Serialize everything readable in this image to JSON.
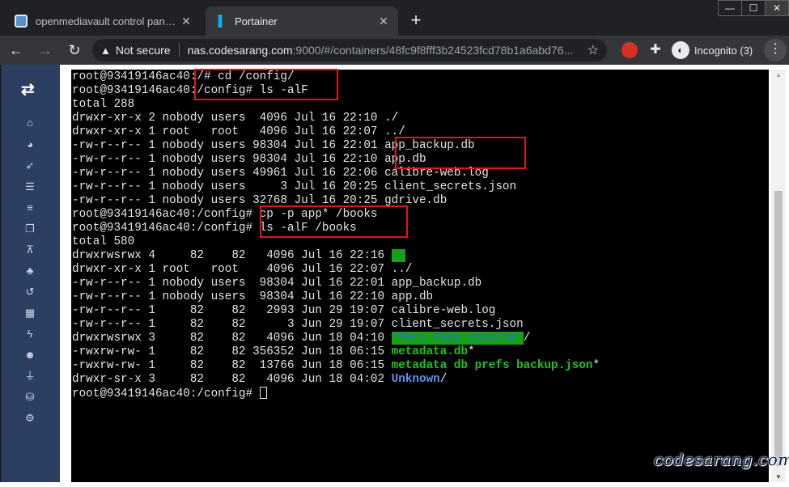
{
  "browser": {
    "tabs": [
      {
        "title": "openmediavault control panel - c",
        "active": false
      },
      {
        "title": "Portainer",
        "active": true
      }
    ],
    "new_tab": "+",
    "window_controls": {
      "minimize": "—",
      "maximize": "☐",
      "close": "✕"
    },
    "toolbar": {
      "back": "←",
      "forward": "→",
      "reload": "↻",
      "security_label": "Not secure",
      "url_host": "nas.codesarang.com",
      "url_rest": ":9000/#/containers/48fc9f8fff3b24523fcd78b1a6abd76...",
      "profile_label": "Incognito (3)"
    }
  },
  "sidebar": {
    "icons": [
      "swap-icon",
      "home-icon",
      "dashboard-icon",
      "rocket-icon",
      "list-icon",
      "server-icon",
      "copy-icon",
      "network-icon",
      "cubes-icon",
      "history-icon",
      "grid-icon",
      "bolt-icon",
      "users-icon",
      "plug-icon",
      "database-icon",
      "settings-icon"
    ]
  },
  "terminal": {
    "lines": [
      "root@93419146ac40:/# cd /config/",
      "root@93419146ac40:/config# ls -alF",
      "total 288",
      "drwxr-xr-x 2 nobody users  4096 Jul 16 22:10 ./",
      "drwxr-xr-x 1 root   root   4096 Jul 16 22:07 ../",
      "-rw-r--r-- 1 nobody users 98304 Jul 16 22:01 app_backup.db",
      "-rw-r--r-- 1 nobody users 98304 Jul 16 22:10 app.db",
      "-rw-r--r-- 1 nobody users 49961 Jul 16 22:06 calibre-web.log",
      "-rw-r--r-- 1 nobody users     3 Jul 16 20:25 client_secrets.json",
      "-rw-r--r-- 1 nobody users 32768 Jul 16 20:25 gdrive.db",
      "root@93419146ac40:/config# cp -p app* /books",
      "root@93419146ac40:/config# ls -alF /books",
      "total 580",
      "drwxrwsrwx 4     82    82   4096 Jul 16 22:16 ",
      "drwxr-xr-x 1 root   root    4096 Jul 16 22:07 ../",
      "-rw-r--r-- 1 nobody users  98304 Jul 16 22:01 app_backup.db",
      "-rw-r--r-- 1 nobody users  98304 Jul 16 22:10 app.db",
      "-rw-r--r-- 1     82    82   2993 Jun 29 19:07 calibre-web.log",
      "-rw-r--r-- 1     82    82      3 Jun 29 19:07 client_secrets.json",
      "drwxrwsrwx 3     82    82   4096 Jun 18 04:10 ",
      "-rwxrw-rw- 1     82    82 356352 Jun 18 06:15 ",
      "-rwxrw-rw- 1     82    82  13766 Jun 18 06:15 ",
      "drwxr-sr-x 3     82    82   4096 Jun 18 04:02 ",
      "root@93419146ac40:/config# "
    ],
    "line13_dir": "./",
    "line19_dir": "'Mary Pope Osborne'",
    "line19_suffix": "/",
    "line20_name": "metadata.db",
    "line20_suffix": "*",
    "line21_name": "metadata db prefs backup.json",
    "line21_suffix": "*",
    "line22_name": "Unknown",
    "line22_suffix": "/"
  },
  "watermark": "codesarang.com",
  "colors": {
    "terminal_bg": "#000000",
    "terminal_fg": "#e5e5e5",
    "highlight_box": "#e2141c",
    "sidebar_bg": "#2d3e63",
    "exec_green": "#1fc41f",
    "dir_blue": "#5e93e8"
  }
}
